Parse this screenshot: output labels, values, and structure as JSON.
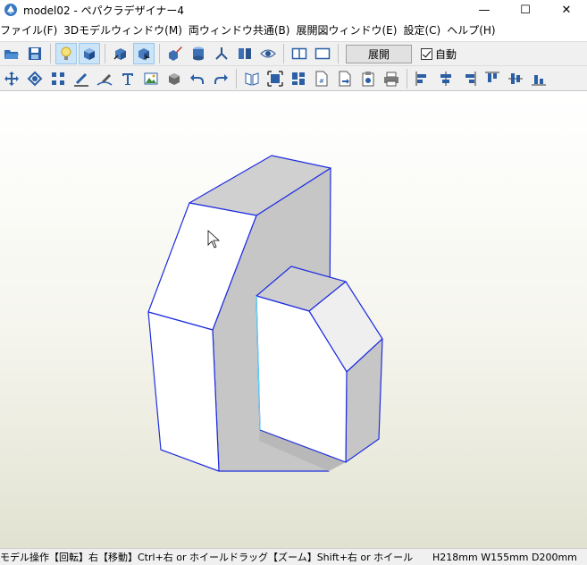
{
  "window": {
    "title": "model02 - ペパクラデザイナー4",
    "minimize": "—",
    "maximize": "☐",
    "close": "✕"
  },
  "menu": [
    "ファイル(F)",
    "3Dモデルウィンドウ(M)",
    "両ウィンドウ共通(B)",
    "展開図ウィンドウ(E)",
    "設定(C)",
    "ヘルプ(H)"
  ],
  "toolbar": {
    "unfold_button": "展開",
    "auto_label": "自動",
    "auto_checked": true
  },
  "statusbar": {
    "help": "モデル操作【回転】右【移動】Ctrl+右 or ホイールドラッグ【ズーム】Shift+右 or ホイール",
    "dimensions": "H218mm W155mm D200mm"
  },
  "colors": {
    "edge": "#1f2ee0",
    "face_white": "#ffffff",
    "face_grey": "#c6c6c6",
    "face_top": "#d0d0d0",
    "accent_active": "#cce4f7"
  }
}
